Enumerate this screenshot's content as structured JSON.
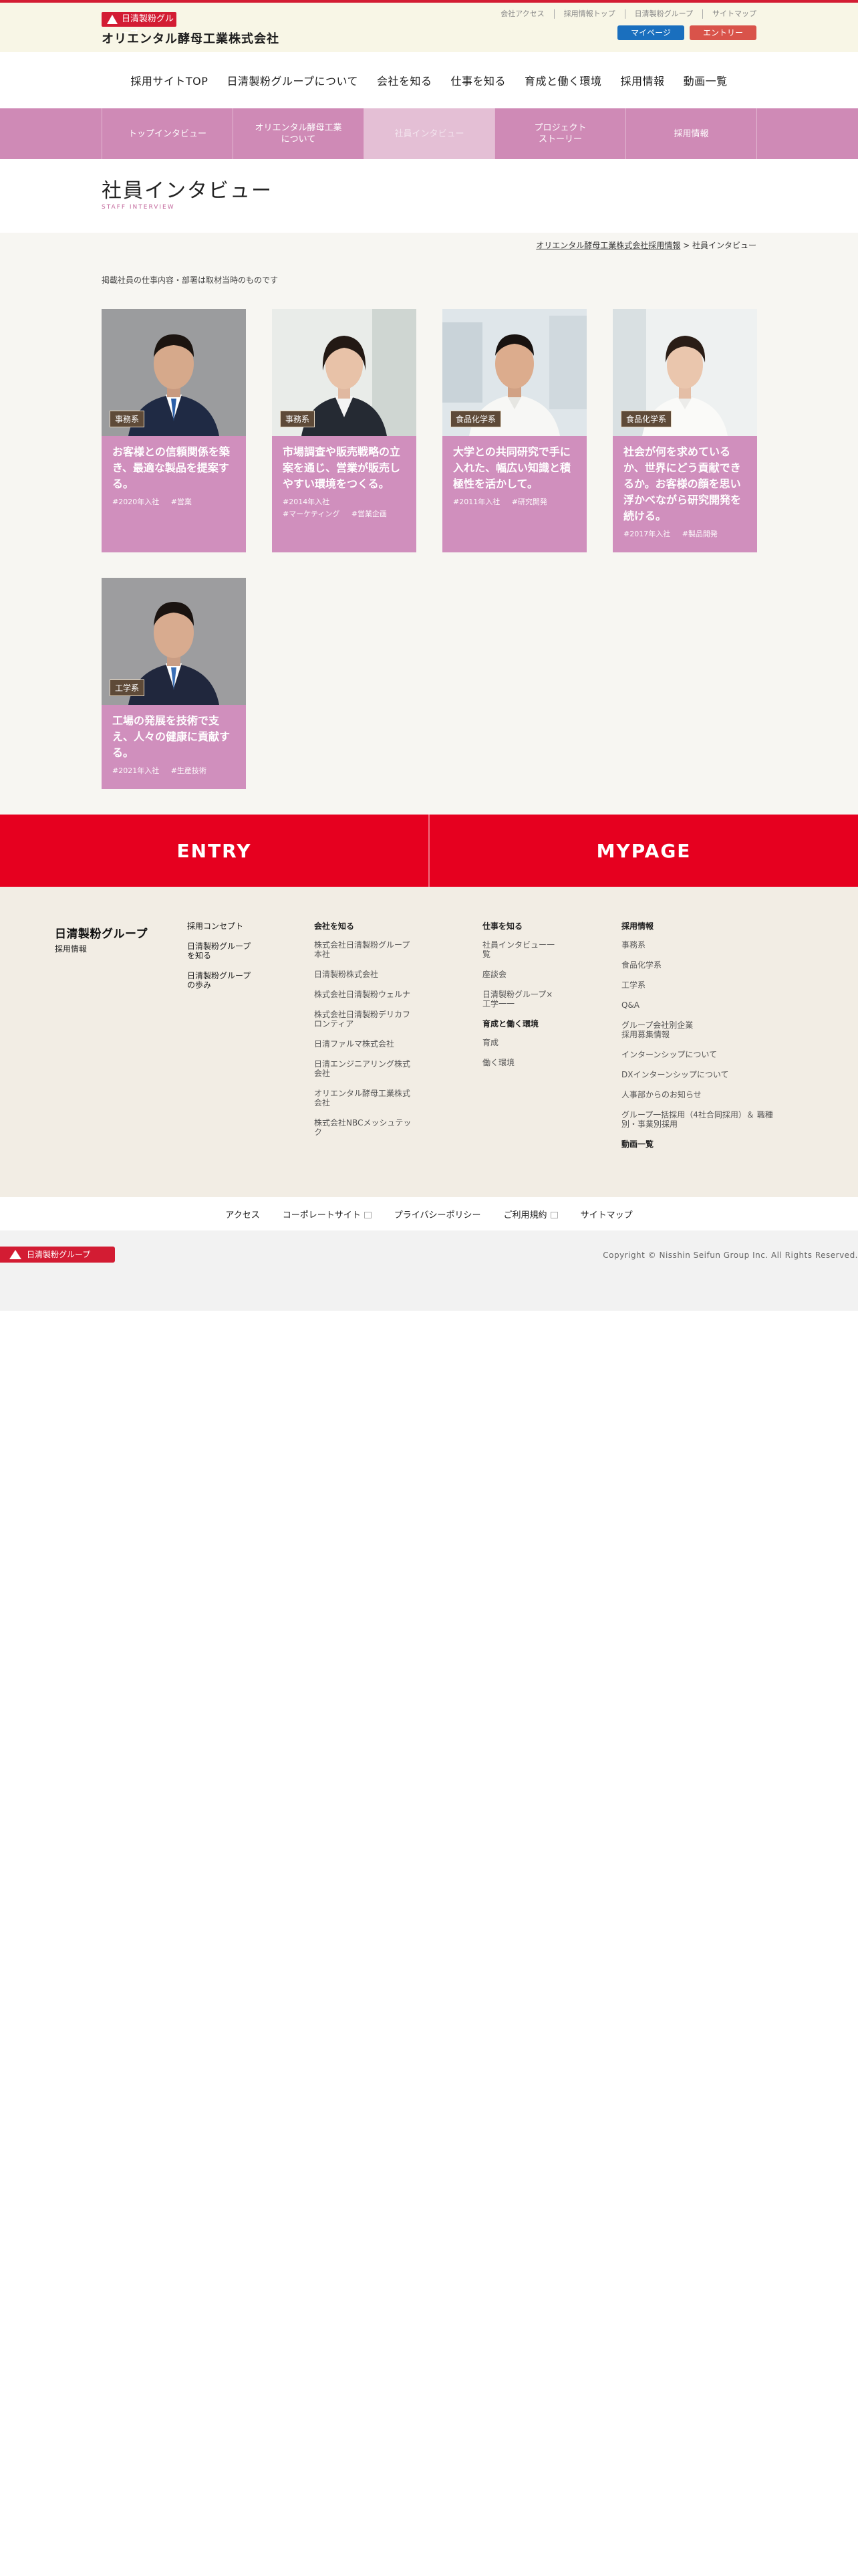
{
  "header": {
    "group_logo": "日清製粉グループ",
    "company": "オリエンタル酵母工業株式会社",
    "util_links": [
      "会社アクセス",
      "採用情報トップ",
      "日清製粉グループ",
      "サイトマップ"
    ],
    "mypage_label": "マイページ",
    "entry_label": "エントリー",
    "colors": {
      "accent": "#d31c33",
      "mypage": "#1a6fbe",
      "entry": "#d9534a"
    }
  },
  "gnav": [
    "採用サイトTOP",
    "日清製粉グループについて",
    "会社を知る",
    "仕事を知る",
    "育成と働く環境",
    "採用情報",
    "動画一覧"
  ],
  "subnav": [
    {
      "label": "トップインタビュー",
      "active": false
    },
    {
      "label": "オリエンタル酵母工業\nについて",
      "active": false
    },
    {
      "label": "社員インタビュー",
      "active": true
    },
    {
      "label": "プロジェクト\nストーリー",
      "active": false
    },
    {
      "label": "採用情報",
      "active": false
    }
  ],
  "page": {
    "title": "社員インタビュー",
    "subtitle": "STAFF INTERVIEW",
    "breadcrumb_link": "オリエンタル酵母工業株式会社採用情報",
    "breadcrumb_sep": ">",
    "breadcrumb_current": "社員インタビュー",
    "note": "掲載社員の仕事内容・部署は取材当時のものです"
  },
  "cards": [
    {
      "badge": "事務系",
      "title": "お客様との信頼関係を築き、最適な製品を提案する。",
      "tags": [
        "#2020年入社",
        "#営業"
      ],
      "icon": "male-employee-photo"
    },
    {
      "badge": "事務系",
      "title": "市場調査や販売戦略の立案を通じ、営業が販売しやすい環境をつくる。",
      "tags": [
        "#2014年入社",
        "#マーケティング",
        "#営業企画"
      ],
      "icon": "female-employee-photo"
    },
    {
      "badge": "食品化学系",
      "title": "大学との共同研究で手に入れた、幅広い知識と積極性を活かして。",
      "tags": [
        "#2011年入社",
        "#研究開発"
      ],
      "icon": "male-researcher-photo"
    },
    {
      "badge": "食品化学系",
      "title": "社会が何を求めているか、世界にどう貢献できるか。お客様の顔を思い浮かべながら研究開発を続ける。",
      "tags": [
        "#2017年入社",
        "#製品開発"
      ],
      "icon": "female-researcher-photo"
    },
    {
      "badge": "工学系",
      "title": "工場の発展を技術で支え、人々の健康に貢献する。",
      "tags": [
        "#2021年入社",
        "#生産技術"
      ],
      "icon": "male-engineer-photo"
    }
  ],
  "cta": {
    "entry": "ENTRY",
    "mypage": "MYPAGE"
  },
  "footer": {
    "logo": "日清製粉グループ",
    "logo_sub": "採用情報",
    "col1": [
      "採用コンセプト",
      "日清製粉グループ\nを知る",
      "日清製粉グループ\nの歩み"
    ],
    "col2_heading": "会社を知る",
    "col2": [
      "株式会社日清製粉グループ\n本社",
      "日清製粉株式会社",
      "株式会社日清製粉ウェルナ",
      "株式会社日清製粉デリカフ\nロンティア",
      "日清ファルマ株式会社",
      "日清エンジニアリング株式\n会社",
      "オリエンタル酵母工業株式\n会社",
      "株式会社NBCメッシュテッ\nク"
    ],
    "col3_heading": "仕事を知る",
    "col3": [
      "社員インタビュー一\n覧",
      "座談会",
      "日清製粉グループ×\n工学一一"
    ],
    "col3_heading2": "育成と働く環境",
    "col3b": [
      "育成",
      "働く環境"
    ],
    "col4_heading": "採用情報",
    "col4": [
      "事務系",
      "食品化学系",
      "工学系",
      "Q&A",
      "グループ会社別企業\n採用募集情報",
      "インターンシップについて",
      "DXインターンシップについて",
      "人事部からのお知らせ",
      "グループ一括採用（4社合同採用）＆ 職種\n別・事業別採用"
    ],
    "col4_heading2": "動画一覧"
  },
  "subfooter": [
    {
      "label": "アクセス",
      "external": false
    },
    {
      "label": "コーポレートサイト",
      "external": true
    },
    {
      "label": "プライバシーポリシー",
      "external": false
    },
    {
      "label": "ご利用規約",
      "external": true
    },
    {
      "label": "サイトマップ",
      "external": false
    }
  ],
  "copyright": {
    "logo": "日清製粉グループ",
    "text": "Copyright © Nisshin Seifun Group Inc. All Rights Reserved."
  }
}
